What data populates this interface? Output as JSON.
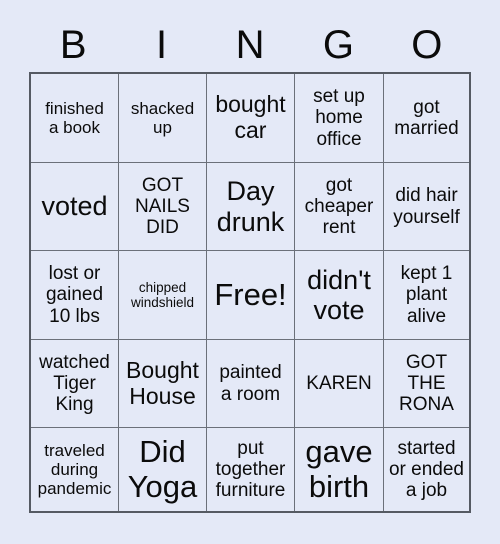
{
  "card": {
    "title": "BINGO",
    "header_letters": [
      "B",
      "I",
      "N",
      "G",
      "O"
    ],
    "colors": {
      "background": "#e4e9f7",
      "cell_background": "#e4e9f7",
      "grid_outer_border": "#555a63",
      "grid_inner_border": "#6b707a",
      "text": "#0b0b0b"
    },
    "free_space_label": "Free!",
    "rows": [
      [
        {
          "text": "finished\na book",
          "size": "s"
        },
        {
          "text": "shacked\nup",
          "size": "s"
        },
        {
          "text": "bought\ncar",
          "size": "l"
        },
        {
          "text": "set up\nhome\noffice",
          "size": "m"
        },
        {
          "text": "got\nmarried",
          "size": "m"
        }
      ],
      [
        {
          "text": "voted",
          "size": "xl"
        },
        {
          "text": "GOT\nNAILS\nDID",
          "size": "m"
        },
        {
          "text": "Day\ndrunk",
          "size": "xl"
        },
        {
          "text": "got\ncheaper\nrent",
          "size": "m"
        },
        {
          "text": "did hair\nyourself",
          "size": "m"
        }
      ],
      [
        {
          "text": "lost or\ngained\n10 lbs",
          "size": "m"
        },
        {
          "text": "chipped\nwindshield",
          "size": "xs"
        },
        {
          "text": "Free!",
          "size": "xxl"
        },
        {
          "text": "didn't\nvote",
          "size": "xl"
        },
        {
          "text": "kept 1\nplant\nalive",
          "size": "m"
        }
      ],
      [
        {
          "text": "watched\nTiger\nKing",
          "size": "m"
        },
        {
          "text": "Bought\nHouse",
          "size": "l"
        },
        {
          "text": "painted\na room",
          "size": "m"
        },
        {
          "text": "KAREN",
          "size": "m"
        },
        {
          "text": "GOT\nTHE\nRONA",
          "size": "m"
        }
      ],
      [
        {
          "text": "traveled\nduring\npandemic",
          "size": "s"
        },
        {
          "text": "Did\nYoga",
          "size": "xxl"
        },
        {
          "text": "put\ntogether\nfurniture",
          "size": "m"
        },
        {
          "text": "gave\nbirth",
          "size": "xxl"
        },
        {
          "text": "started\nor ended\na job",
          "size": "m"
        }
      ]
    ]
  }
}
